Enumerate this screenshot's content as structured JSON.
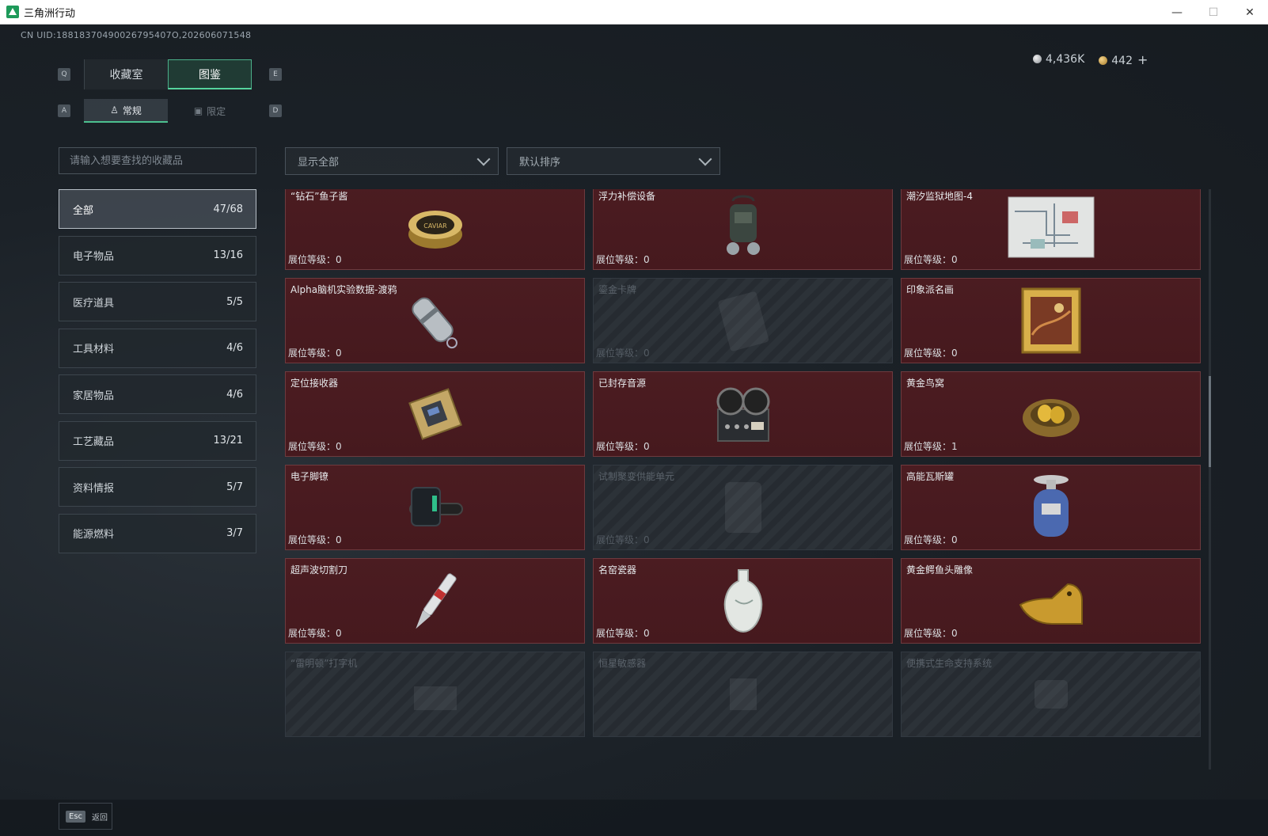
{
  "window": {
    "title": "三角洲行动",
    "min": "—",
    "max": "☐",
    "close": "✕"
  },
  "uid_text": "CN UID:18818370490026795407O,202606071548",
  "currency": {
    "silver": "4,436K",
    "gold": "442",
    "plus": "+"
  },
  "keys": {
    "q": "Q",
    "e": "E",
    "a": "A",
    "d": "D"
  },
  "tabs": [
    {
      "label": "收藏室"
    },
    {
      "label": "图鉴"
    }
  ],
  "subtabs": [
    {
      "label": "常规"
    },
    {
      "label": "限定"
    }
  ],
  "search": {
    "placeholder": "请输入想要查找的收藏品"
  },
  "categories": [
    {
      "label": "全部",
      "count": "47/68"
    },
    {
      "label": "电子物品",
      "count": "13/16"
    },
    {
      "label": "医疗道具",
      "count": "5/5"
    },
    {
      "label": "工具材料",
      "count": "4/6"
    },
    {
      "label": "家居物品",
      "count": "4/6"
    },
    {
      "label": "工艺藏品",
      "count": "13/21"
    },
    {
      "label": "资料情报",
      "count": "5/7"
    },
    {
      "label": "能源燃料",
      "count": "3/7"
    }
  ],
  "filter": {
    "show": "显示全部",
    "sort": "默认排序"
  },
  "level_prefix": "展位等级：",
  "cards": [
    {
      "name": "",
      "level": "展位等级：0",
      "locked": true,
      "icon": "candelabra-icon"
    },
    {
      "name": "",
      "level": "展位等级：0",
      "locked": false,
      "icon": "chess-set-icon"
    },
    {
      "name": "",
      "level": "展位等级：0",
      "locked": false,
      "icon": "machine-icon"
    },
    {
      "name": "“钻石”鱼子酱",
      "level": "展位等级：0",
      "locked": false,
      "icon": "caviar-tin-icon"
    },
    {
      "name": "浮力补偿设备",
      "level": "展位等级：0",
      "locked": false,
      "icon": "diving-gear-icon"
    },
    {
      "name": "潮汐监狱地图-4",
      "level": "展位等级：0",
      "locked": false,
      "icon": "map-icon"
    },
    {
      "name": "Alpha脑机实验数据-渡鸦",
      "level": "展位等级：0",
      "locked": false,
      "icon": "data-capsule-icon"
    },
    {
      "name": "鎏金卡牌",
      "level": "展位等级：0",
      "locked": true,
      "icon": "card-icon"
    },
    {
      "name": "印象派名画",
      "level": "展位等级：0",
      "locked": false,
      "icon": "framed-painting-icon"
    },
    {
      "name": "定位接收器",
      "level": "展位等级：0",
      "locked": false,
      "icon": "receiver-icon"
    },
    {
      "name": "已封存音源",
      "level": "展位等级：0",
      "locked": false,
      "icon": "reel-recorder-icon"
    },
    {
      "name": "黄金鸟窝",
      "level": "展位等级：1",
      "locked": false,
      "icon": "golden-nest-icon"
    },
    {
      "name": "电子脚镣",
      "level": "展位等级：0",
      "locked": false,
      "icon": "ankle-monitor-icon"
    },
    {
      "name": "试制聚变供能单元",
      "level": "展位等级：0",
      "locked": true,
      "icon": "fusion-unit-icon"
    },
    {
      "name": "高能瓦斯罐",
      "level": "展位等级：0",
      "locked": false,
      "icon": "gas-canister-icon"
    },
    {
      "name": "超声波切割刀",
      "level": "展位等级：0",
      "locked": false,
      "icon": "cutting-knife-icon"
    },
    {
      "name": "名窑瓷器",
      "level": "展位等级：0",
      "locked": false,
      "icon": "porcelain-vase-icon"
    },
    {
      "name": "黄金鳄鱼头雕像",
      "level": "展位等级：0",
      "locked": false,
      "icon": "crocodile-head-icon"
    },
    {
      "name": "“雷明顿”打字机",
      "level": "",
      "locked": true,
      "icon": "typewriter-icon"
    },
    {
      "name": "恒星敏感器",
      "level": "",
      "locked": true,
      "icon": "star-sensor-icon"
    },
    {
      "name": "便携式生命支持系统",
      "level": "",
      "locked": true,
      "icon": "life-support-icon"
    }
  ],
  "footer": {
    "key": "Esc",
    "label": "返回"
  }
}
